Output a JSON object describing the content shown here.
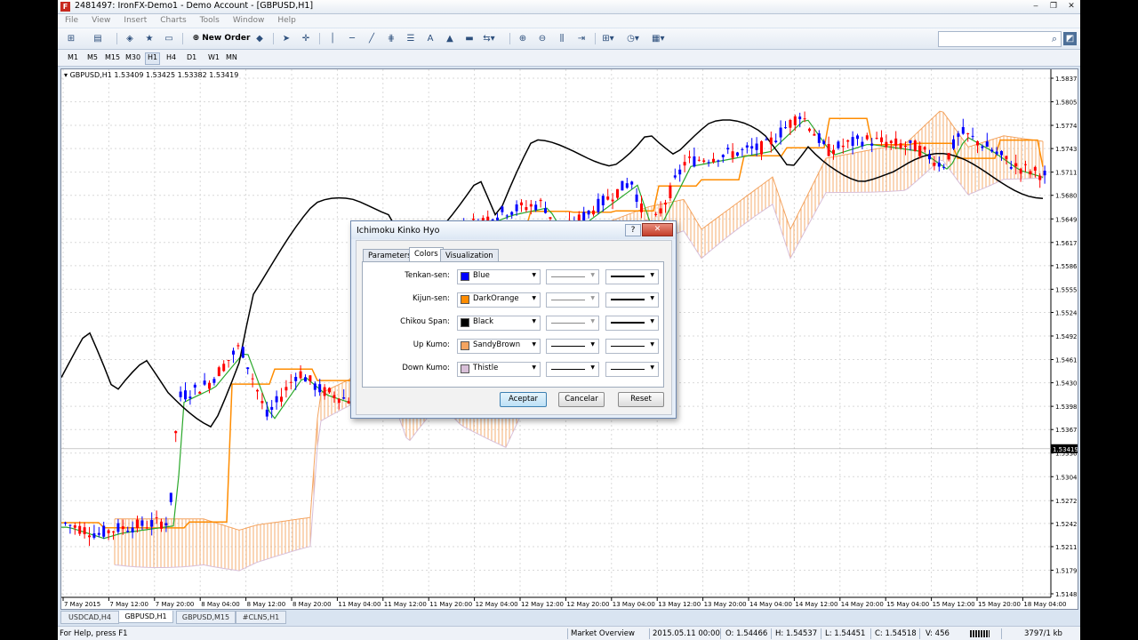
{
  "window": {
    "title": "2481497: IronFX-Demo1 - Demo Account - [GBPUSD,H1]",
    "logo": "F",
    "controls": [
      "‒",
      "❐",
      "✕"
    ]
  },
  "menu": {
    "items": [
      "File",
      "View",
      "Insert",
      "Charts",
      "Tools",
      "Window",
      "Help"
    ],
    "mdi_controls": [
      "‒",
      "❐",
      "✕"
    ]
  },
  "toolbar": {
    "new_order_label": "New Order",
    "search_placeholder": ""
  },
  "timeframes": [
    "M1",
    "M5",
    "M15",
    "M30",
    "H1",
    "H4",
    "D1",
    "W1",
    "MN"
  ],
  "timeframe_active": "H1",
  "chart": {
    "header": "GBPUSD,H1  1.53409 1.53425 1.53382 1.53419",
    "price_labels": [
      "1.58370",
      "1.58055",
      "1.57740",
      "1.57430",
      "1.57115",
      "1.56805",
      "1.56490",
      "1.56175",
      "1.55865",
      "1.55550",
      "1.55240",
      "1.54925",
      "1.54610",
      "1.54300",
      "1.53985",
      "1.53675",
      "1.53360",
      "1.53045",
      "1.52725",
      "1.52420",
      "1.52110",
      "1.51795",
      "1.51480"
    ],
    "current_price": "1.53419",
    "time_labels": [
      "7 May 2015",
      "7 May 12:00",
      "7 May 20:00",
      "8 May 04:00",
      "8 May 12:00",
      "8 May 20:00",
      "11 May 04:00",
      "11 May 12:00",
      "11 May 20:00",
      "12 May 04:00",
      "12 May 12:00",
      "12 May 20:00",
      "13 May 04:00",
      "13 May 12:00",
      "13 May 20:00",
      "14 May 04:00",
      "14 May 12:00",
      "14 May 20:00",
      "15 May 04:00",
      "15 May 12:00",
      "15 May 20:00",
      "18 May 04:00"
    ],
    "colors": {
      "bull": "#0000ff",
      "bear": "#ff0000",
      "tenkan": "#0000ff",
      "kijun": "#ff8c00",
      "chikou": "#000000",
      "up_kumo": "#f4a460",
      "down_kumo": "#d8bfd8",
      "green_line": "#2aa82a"
    }
  },
  "tabs": [
    {
      "label": "USDCAD,H4",
      "active": false
    },
    {
      "label": "GBPUSD,H1",
      "active": true
    },
    {
      "label": "GBPUSD,M15",
      "active": false
    },
    {
      "label": "#CLN5,H1",
      "active": false
    }
  ],
  "status": {
    "help": "For Help, press F1",
    "profile": "Market Overview",
    "datetime": "2015.05.11 00:00",
    "open": "O: 1.54466",
    "high": "H: 1.54537",
    "low": "L: 1.54451",
    "close": "C: 1.54518",
    "volume": "V: 456",
    "traffic": "3797/1 kb"
  },
  "dialog": {
    "title": "Ichimoku Kinko Hyo",
    "help_label": "?",
    "close_label": "✕",
    "tabs": [
      "Parameters",
      "Colors",
      "Visualization"
    ],
    "active_tab": "Colors",
    "rows": [
      {
        "label": "Tenkan-sen:",
        "color_name": "Blue",
        "color": "#0000ff",
        "style_enabled": false
      },
      {
        "label": "Kijun-sen:",
        "color_name": "DarkOrange",
        "color": "#ff8c00",
        "style_enabled": false
      },
      {
        "label": "Chikou Span:",
        "color_name": "Black",
        "color": "#000000",
        "style_enabled": false
      },
      {
        "label": "Up Kumo:",
        "color_name": "SandyBrown",
        "color": "#f4a460",
        "style_enabled": true
      },
      {
        "label": "Down Kumo:",
        "color_name": "Thistle",
        "color": "#d8bfd8",
        "style_enabled": true
      }
    ],
    "buttons": {
      "ok": "Aceptar",
      "cancel": "Cancelar",
      "reset": "Reset"
    }
  }
}
